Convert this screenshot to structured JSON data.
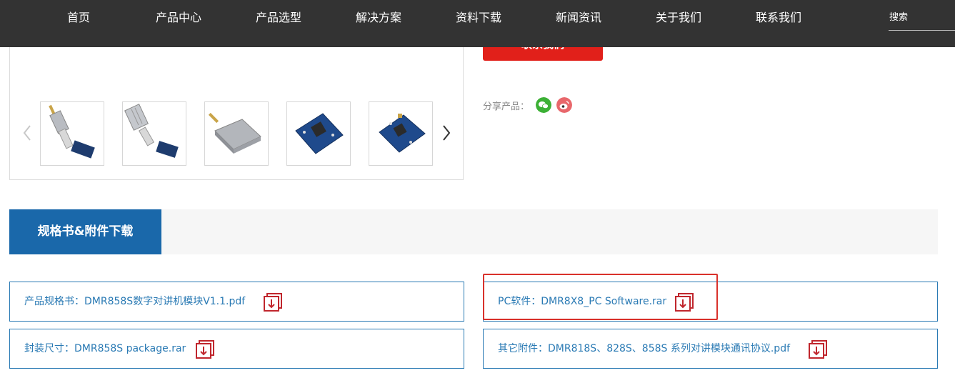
{
  "nav": {
    "items": [
      "首页",
      "产品中心",
      "产品选型",
      "解决方案",
      "资料下载",
      "新闻资讯",
      "关于我们",
      "联系我们"
    ],
    "search_label": "搜索"
  },
  "product": {
    "contact_button": "联系我们",
    "share_label": "分享产品：",
    "share_icons": [
      "wechat-icon",
      "weibo-icon"
    ]
  },
  "gallery": {
    "thumbnails": [
      "module-with-cable",
      "module-with-heatsink",
      "shielded-module",
      "blue-board-module",
      "blue-board-module-2"
    ]
  },
  "tabs": {
    "active_label": "规格书&附件下载"
  },
  "downloads": [
    {
      "label": "产品规格书：DMR858S数字对讲机模块V1.1.pdf"
    },
    {
      "label": "PC软件：DMR8X8_PC Software.rar"
    },
    {
      "label": "封装尺寸：DMR858S package.rar"
    },
    {
      "label": "其它附件：DMR818S、828S、858S 系列对讲模块通讯协议.pdf"
    }
  ],
  "colors": {
    "nav_bg": "#333333",
    "accent_blue": "#1a68aa",
    "link_blue": "#2a7ab4",
    "button_red": "#e1201a",
    "icon_red": "#c0262d"
  }
}
